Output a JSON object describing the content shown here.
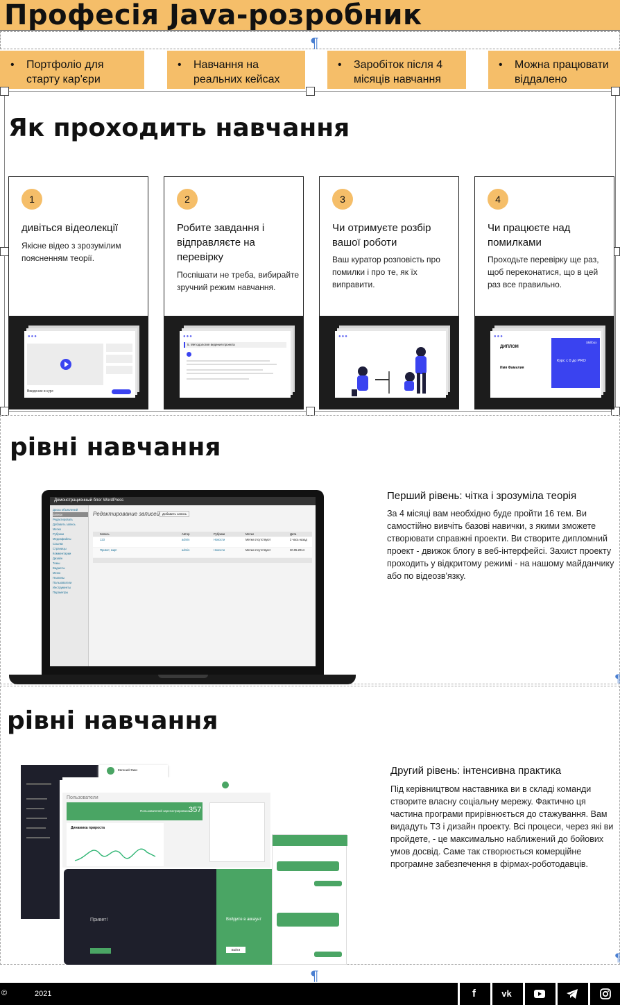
{
  "header": {
    "title": "Професія Java-розробник",
    "features": [
      "Портфоліо для старту кар'єри",
      "Навчання на реальних кейсах",
      "Заробіток після 4 місяців навчання",
      "Можна працювати віддалено"
    ],
    "bullet": "•",
    "pilcrow": "¶"
  },
  "process": {
    "title": "Як проходить навчання",
    "steps": [
      {
        "num": "1",
        "title": "дивіться відеолекції",
        "desc": "Якісне відео з зрозумілим поясненням теорії."
      },
      {
        "num": "2",
        "title": "Робите завдання і відправляєте на перевірку",
        "desc": "Поспішати не треба, вибирайте зручний режим навчання."
      },
      {
        "num": "3",
        "title": "Чи отримуєте розбір вашої роботи",
        "desc": "Ваш куратор розповість про помилки і про те, як їх виправити."
      },
      {
        "num": "4",
        "title": "Чи працюєте над помилками",
        "desc": "Проходьте перевірку ще раз, щоб переконатися, що в цей раз все правильно."
      }
    ],
    "shots": {
      "video_caption": "Введение в курс",
      "task_header": "5. Методология ведения проекта",
      "diploma_label": "ДИПЛОМ",
      "diploma_name": "Имя Фамилия",
      "diploma_course": "Курс с 0 до PRO",
      "diploma_brand": "Skillbox"
    }
  },
  "level1": {
    "section_title": "рівні навчання",
    "heading": "Перший рівень: чітка і зрозуміла теорія",
    "text": "За 4 місяці вам необхідно буде пройти 16 тем. Ви самостійно вивчіть базові навички, з якими зможете створювати справжні проекти. Ви створите дипломний проект - движок блогу в веб-інтерфейсі. Захист проекту проходить у відкритому режимі - на нашому майданчику або по відеозв'язку.",
    "screen": {
      "top_title": "Демонстрационный блог WordPress",
      "page_title": "Редактирование записей",
      "add_button": "Добавить запись",
      "sidebar": [
        "Доска объявлений",
        "Записи",
        "Редактировать",
        "Добавить запись",
        "Метки",
        "Рубрики",
        "Медиафайлы",
        "Ссылки",
        "Страницы",
        "Комментарии",
        "Дизайн",
        "Темы",
        "Виджеты",
        "Меню",
        "Плагины",
        "Пользователи",
        "Инструменты",
        "Параметры"
      ],
      "columns": [
        "Запись",
        "Автор",
        "Рубрики",
        "Метки",
        "Дата"
      ],
      "rows": [
        {
          "title": "123",
          "author": "admin",
          "cat": "Новости",
          "tags": "Метки отсутствуют",
          "date": "2 часа назад"
        },
        {
          "title": "Привет, мир!",
          "author": "admin",
          "cat": "Новости",
          "tags": "Метки отсутствуют",
          "date": "30.05.2014"
        }
      ]
    }
  },
  "level2": {
    "section_title": "рівні навчання",
    "heading": "Другий рівень: інтенсивна практика",
    "text": "Під керівництвом наставника ви в складі команди створите власну соціальну мережу. Фактично ця частина програми прирівнюється до стажування. Вам видадуть ТЗ і дизайн проекту. Всі процеси, через які ви пройдете, - це максимально наближений до бойових умов досвід. Саме так створюється комерційне програмне забезпечення в фірмах-роботодавців.",
    "screen": {
      "users_title": "Пользователи",
      "registered": "Пользователей зарегистрировано",
      "count": "357",
      "growth": "Динамика прироста",
      "greeting": "Привет!",
      "login": "Войдите в аккаунт",
      "login_btn": "Войти",
      "notify_name": "Евгений Фикс"
    }
  },
  "footer": {
    "copyright": "©",
    "year": "2021",
    "socials": [
      "f",
      "vk",
      "youtube",
      "telegram",
      "instagram"
    ]
  },
  "colors": {
    "accent": "#f5be69",
    "green": "#4aa564",
    "dark": "#1c1c1c",
    "blue": "#3a43f0"
  }
}
